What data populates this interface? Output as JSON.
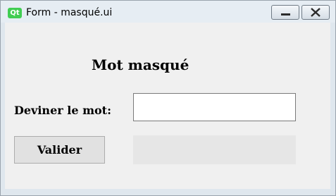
{
  "window": {
    "title": "Form - masqué.ui",
    "logo_text": "Qt",
    "minimize_icon": "minimize-icon",
    "close_icon": "close-icon"
  },
  "form": {
    "heading": "Mot masqué",
    "guess_label": "Deviner le mot:",
    "guess_value": "",
    "validate_label": "Valider",
    "result_text": ""
  },
  "colors": {
    "qt_green": "#41cd52",
    "client_bg": "#f0f0f0",
    "button_bg": "#e1e1e1",
    "result_bg": "#e6e6e6"
  }
}
